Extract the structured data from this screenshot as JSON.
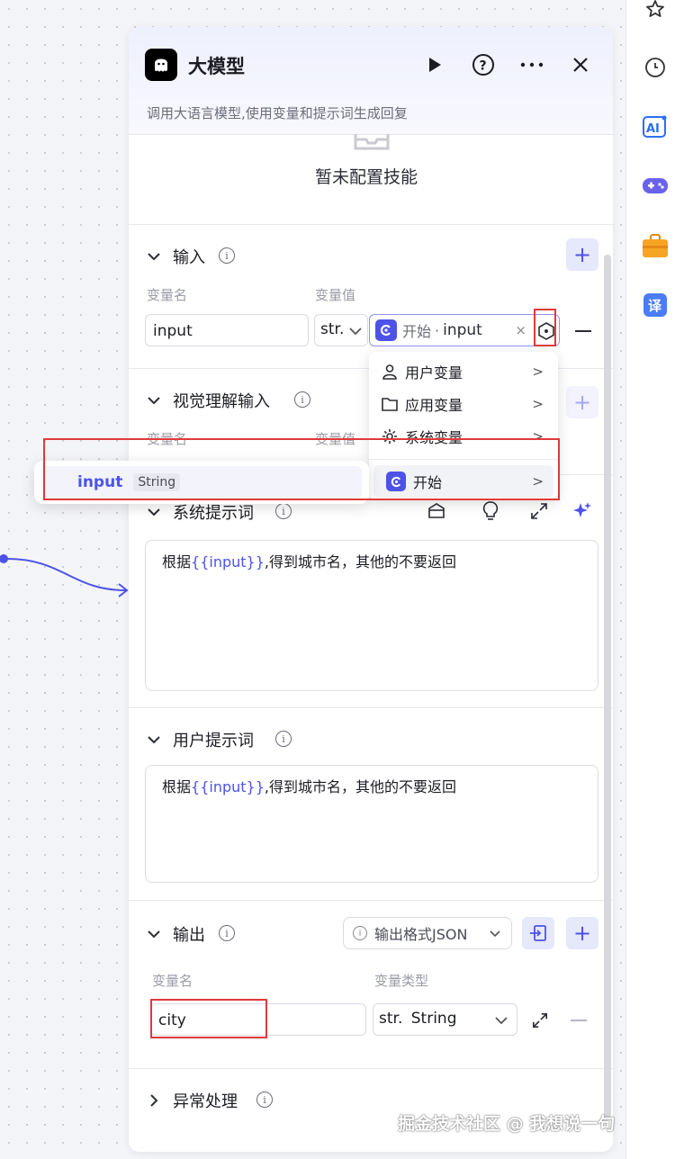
{
  "panel": {
    "title": "大模型",
    "subtitle": "调用大语言模型,使用变量和提示词生成回复",
    "skills_empty": "暂未配置技能"
  },
  "input_section": {
    "title": "输入",
    "col_name": "变量名",
    "col_value": "变量值",
    "row": {
      "name": "input",
      "type_label": "str.",
      "ref_source": "开始",
      "ref_sep": "·",
      "ref_var": "input",
      "clear": "×"
    }
  },
  "dropdown": {
    "items": [
      {
        "label": "用户变量",
        "icon": "user-icon"
      },
      {
        "label": "应用变量",
        "icon": "folder-icon"
      },
      {
        "label": "系统变量",
        "icon": "gear-icon"
      },
      {
        "label": "开始",
        "icon": "start-node-icon"
      }
    ],
    "arrow": ">"
  },
  "submenu": {
    "var_name": "input",
    "var_type": "String"
  },
  "vision_section": {
    "title": "视觉理解输入",
    "col_name": "变量名",
    "col_value": "变量值"
  },
  "system_prompt": {
    "title": "系统提示词",
    "text_before": "根据",
    "token": "{{input}}",
    "text_after": ",得到城市名，其他的不要返回"
  },
  "user_prompt": {
    "title": "用户提示词",
    "text_before": "根据",
    "token": "{{input}}",
    "text_after": ",得到城市名，其他的不要返回"
  },
  "output_section": {
    "title": "输出",
    "format_label": "输出格式JSON",
    "col_name": "变量名",
    "col_type": "变量类型",
    "row": {
      "name": "city",
      "type_prefix": "str.",
      "type": "String"
    }
  },
  "exception_section": {
    "title": "异常处理"
  },
  "watermark": "掘金技术社区 @ 我想说一句",
  "colors": {
    "accent": "#4d53e8",
    "highlight_box": "#e03a3a"
  }
}
